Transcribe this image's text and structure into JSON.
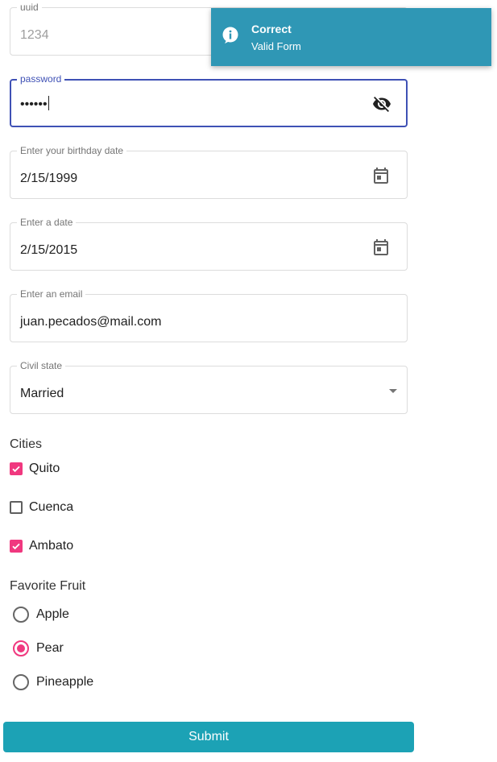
{
  "form": {
    "uuid": {
      "label": "uuid",
      "value": "1234"
    },
    "password": {
      "label": "password",
      "value": "••••••",
      "icon": "visibility-off-icon"
    },
    "birthday": {
      "label": "Enter your birthday date",
      "value": "2/15/1999",
      "icon": "calendar-icon"
    },
    "date": {
      "label": "Enter a date",
      "value": "2/15/2015",
      "icon": "calendar-icon"
    },
    "email": {
      "label": "Enter an email",
      "value": "juan.pecados@mail.com"
    },
    "civil_state": {
      "label": "Civil state",
      "value": "Married"
    },
    "cities": {
      "title": "Cities",
      "options": [
        {
          "label": "Quito",
          "checked": true
        },
        {
          "label": "Cuenca",
          "checked": false
        },
        {
          "label": "Ambato",
          "checked": true
        }
      ]
    },
    "fruit": {
      "title": "Favorite Fruit",
      "options": [
        {
          "label": "Apple",
          "selected": false
        },
        {
          "label": "Pear",
          "selected": true
        },
        {
          "label": "Pineapple",
          "selected": false
        }
      ]
    },
    "submit_label": "Submit"
  },
  "toast": {
    "title": "Correct",
    "message": "Valid Form",
    "icon": "info-icon"
  },
  "colors": {
    "accent": "#f0387f",
    "primary": "#3f51b5",
    "button": "#1ca2b5",
    "toast": "#2f97b5"
  }
}
